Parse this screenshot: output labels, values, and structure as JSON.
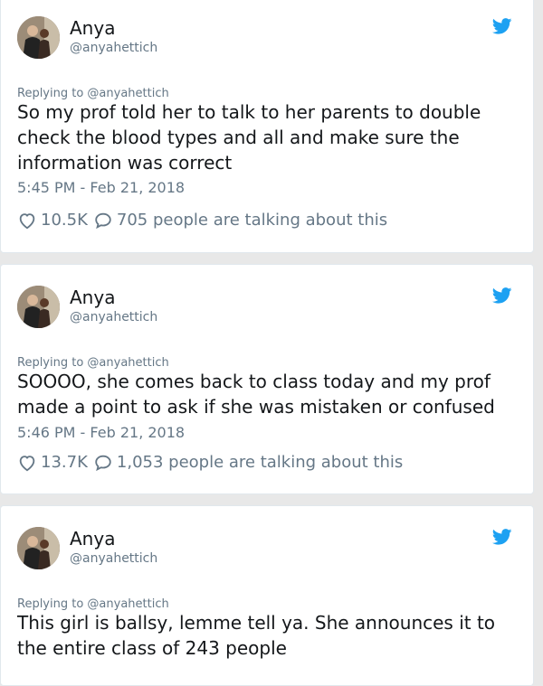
{
  "colors": {
    "twitter_blue": "#1da1f2",
    "secondary_text": "#657786",
    "primary_text": "#14171a"
  },
  "icons": {
    "like": "heart-icon",
    "reply": "speech-bubble-icon",
    "brand": "twitter-bird-icon"
  },
  "tweets": [
    {
      "name": "Anya",
      "handle": "@anyahettich",
      "reply_to": "Replying to @anyahettich",
      "text": "So my prof told her to talk to her parents to double\ncheck the blood types and all and make sure the\ninformation was correct",
      "timestamp": "5:45 PM - Feb 21, 2018",
      "likes": "10.5K",
      "talking": "705 people are talking about this"
    },
    {
      "name": "Anya",
      "handle": "@anyahettich",
      "reply_to": "Replying to @anyahettich",
      "text": "SOOOO, she comes back to class today and my prof\nmade a point to ask if she was mistaken or confused",
      "timestamp": "5:46 PM - Feb 21, 2018",
      "likes": "13.7K",
      "talking": "1,053 people are talking about this"
    },
    {
      "name": "Anya",
      "handle": "@anyahettich",
      "reply_to": "Replying to @anyahettich",
      "text": "This girl is ballsy, lemme tell ya. She announces it to\nthe entire class of 243 people"
    }
  ]
}
